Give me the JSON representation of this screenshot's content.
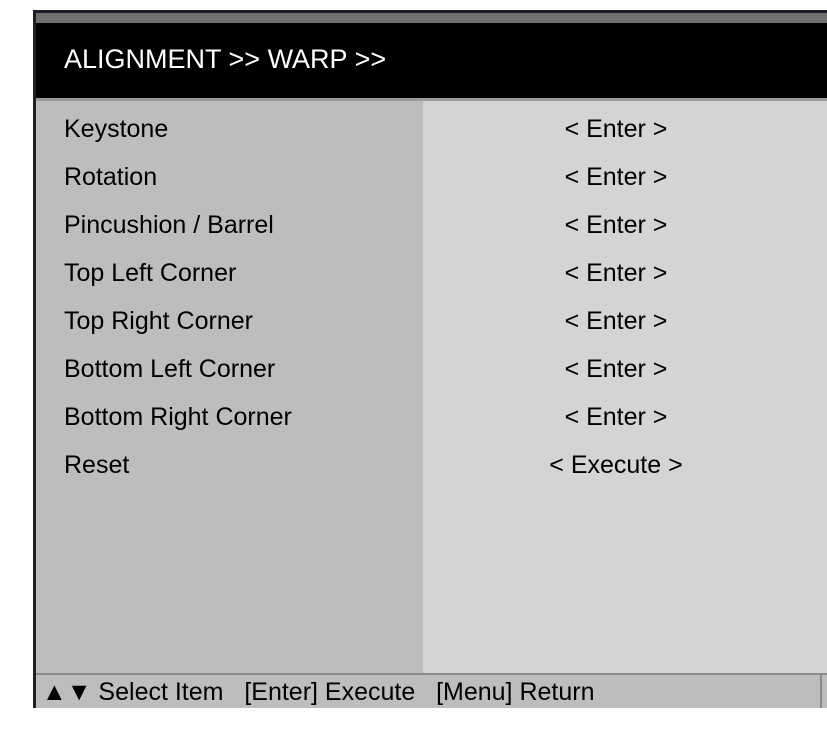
{
  "header": {
    "title": "ALIGNMENT >> WARP >>"
  },
  "menu": {
    "items": [
      {
        "label": "Keystone",
        "value": "< Enter >"
      },
      {
        "label": "Rotation",
        "value": "< Enter >"
      },
      {
        "label": "Pincushion / Barrel",
        "value": "< Enter >"
      },
      {
        "label": "Top Left Corner",
        "value": "< Enter >"
      },
      {
        "label": "Top Right Corner",
        "value": "< Enter >"
      },
      {
        "label": "Bottom Left Corner",
        "value": "< Enter >"
      },
      {
        "label": "Bottom Right Corner",
        "value": "< Enter >"
      },
      {
        "label": "Reset",
        "value": "< Execute >"
      }
    ]
  },
  "footer": {
    "hint": "▲▼ Select Item   [Enter] Execute   [Menu] Return"
  },
  "colors": {
    "title_bg": "#000000",
    "label_column_bg": "#bdbdbd",
    "value_column_bg": "#d4d4d4",
    "text": "#000000"
  }
}
